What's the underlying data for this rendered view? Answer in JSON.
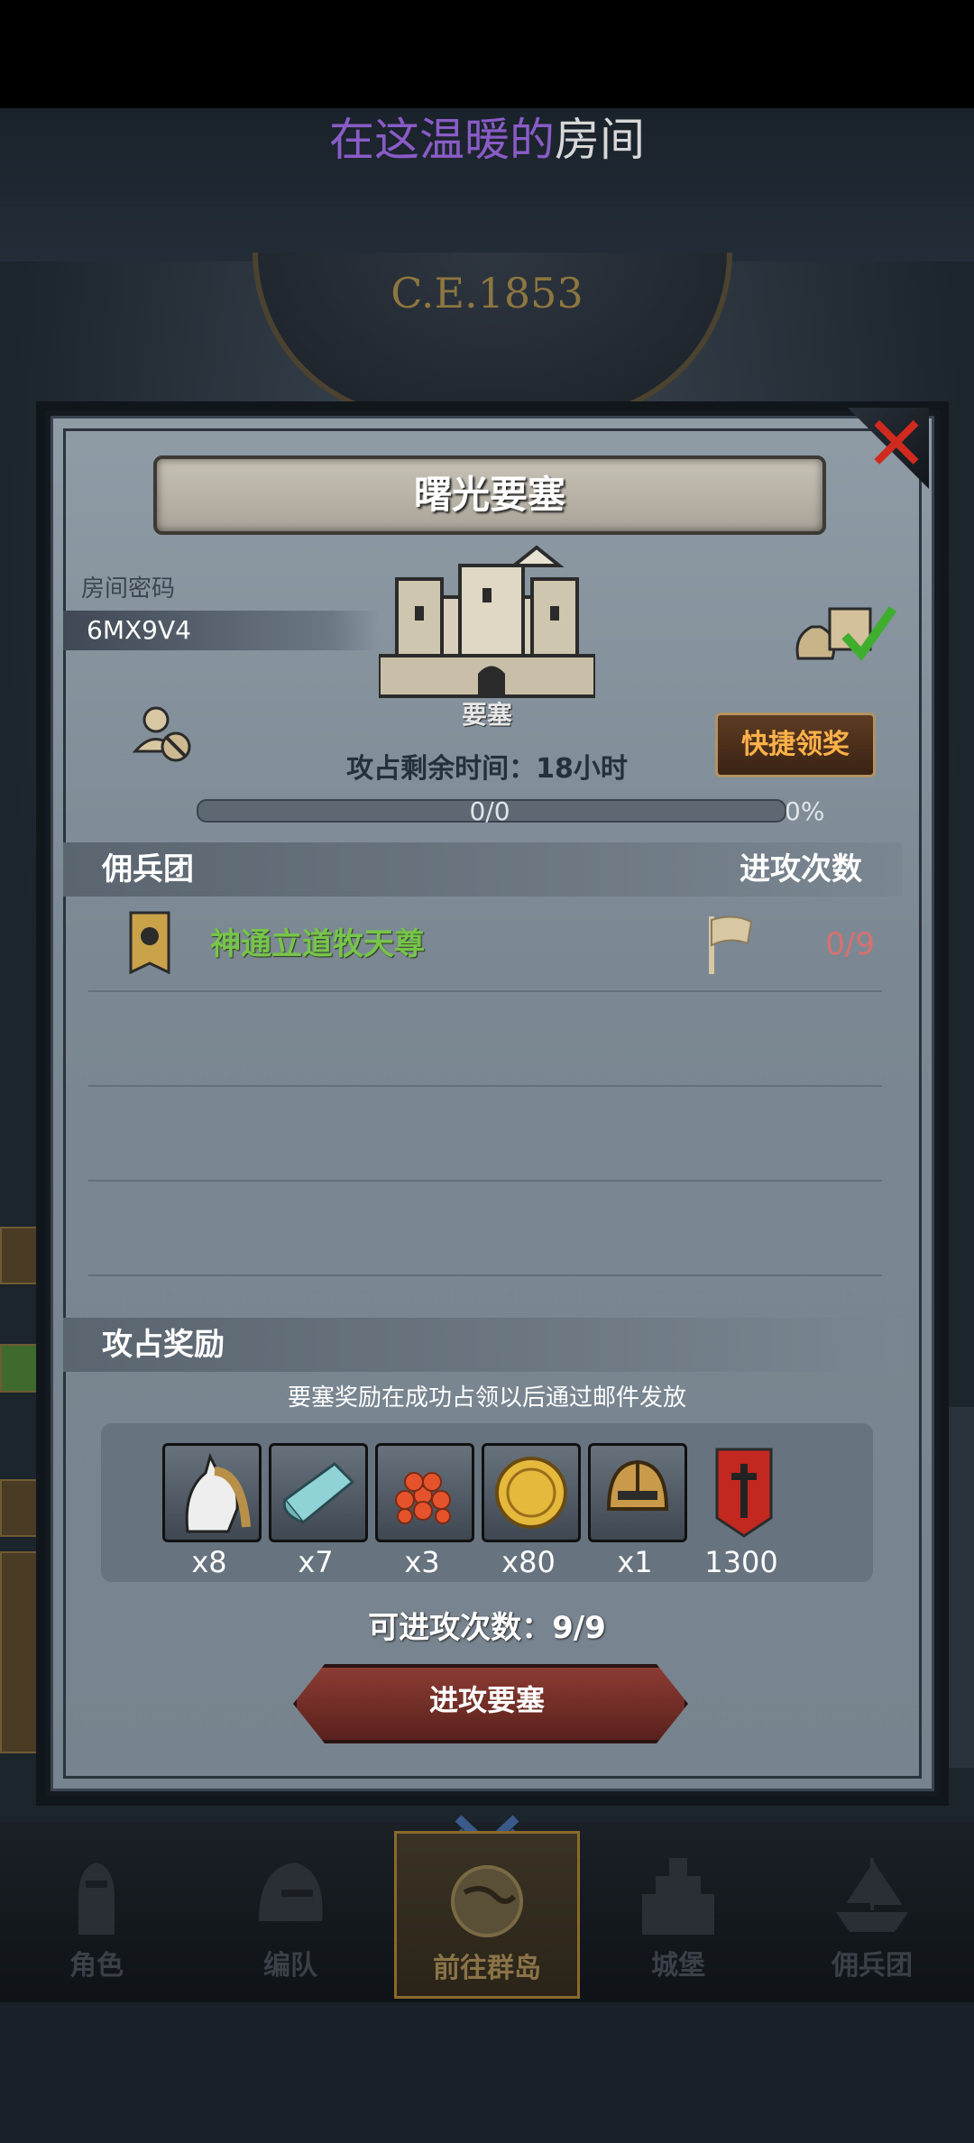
{
  "lyric": {
    "highlight": "在这温暖的",
    "rest": "房间"
  },
  "era": "C.E.1853",
  "modal": {
    "title": "曙光要塞",
    "room_code_label": "房间密码",
    "room_code": "6MX9V4",
    "fort_type": "要塞",
    "quick_claim": "快捷领奖",
    "remaining_time": "攻占剩余时间：18小时",
    "progress": {
      "value": 0,
      "text": "0/0",
      "percent": "0%"
    },
    "section_guild": {
      "left": "佣兵团",
      "right": "进攻次数"
    },
    "guild": {
      "name": "神通立道牧天尊",
      "attacks": "0/9"
    },
    "section_rewards": "攻占奖励",
    "reward_note": "要塞奖励在成功占领以后通过邮件发放",
    "rewards": [
      {
        "icon": "horse-icon",
        "qty": "x8"
      },
      {
        "icon": "cloth-icon",
        "qty": "x7"
      },
      {
        "icon": "berries-icon",
        "qty": "x3"
      },
      {
        "icon": "gold-coin-icon",
        "qty": "x80"
      },
      {
        "icon": "helmet-icon",
        "qty": "x1"
      },
      {
        "icon": "guild-banner-icon",
        "qty": "1300"
      }
    ],
    "attacks_left": "可进攻次数：9/9",
    "attack_button": "进攻要塞"
  },
  "nav": [
    {
      "label": "角色",
      "icon": "knight-icon"
    },
    {
      "label": "编队",
      "icon": "helmet-icon"
    },
    {
      "label": "前往群岛",
      "icon": "globe-icon"
    },
    {
      "label": "城堡",
      "icon": "castle-icon"
    },
    {
      "label": "佣兵团",
      "icon": "ship-icon"
    }
  ],
  "colors": {
    "accent_gold": "#c8a24a",
    "guild_green": "#77c44b",
    "count_red": "#d9706e",
    "close_red": "#d02a1e"
  }
}
